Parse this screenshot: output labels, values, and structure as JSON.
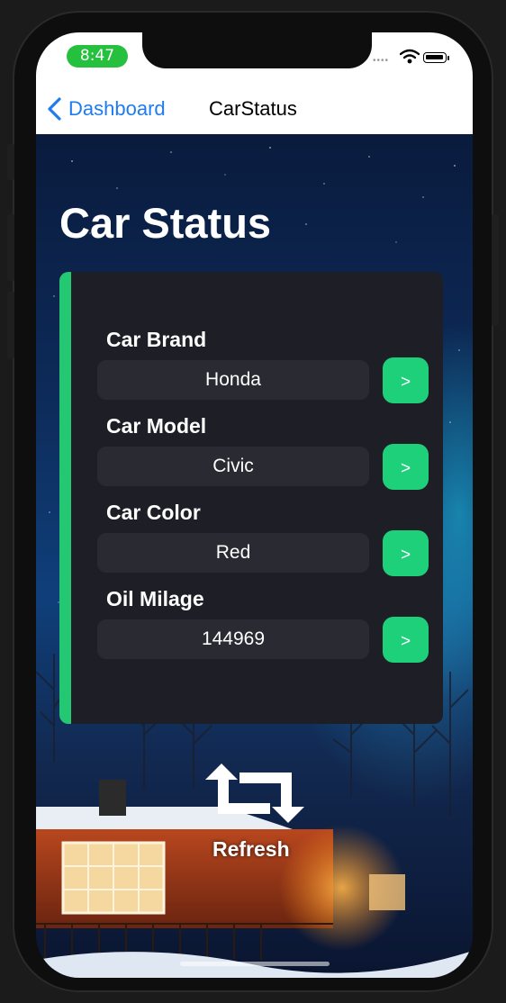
{
  "status_bar": {
    "time": "8:47",
    "icons": [
      "cellular-icon",
      "wifi-icon",
      "battery-icon"
    ]
  },
  "nav": {
    "back_label": "Dashboard",
    "title": "CarStatus"
  },
  "page": {
    "heading": "Car Status"
  },
  "fields": [
    {
      "label": "Car Brand",
      "value": "Honda",
      "button": ">"
    },
    {
      "label": "Car Model",
      "value": "Civic",
      "button": ">"
    },
    {
      "label": "Car Color",
      "value": "Red",
      "button": ">"
    },
    {
      "label": "Oil Milage",
      "value": "144969",
      "button": ">"
    }
  ],
  "refresh": {
    "label": "Refresh"
  },
  "colors": {
    "accent": "#24c873",
    "button": "#1ed07a",
    "link": "#1e7cf0",
    "card": "#1e1e26"
  }
}
